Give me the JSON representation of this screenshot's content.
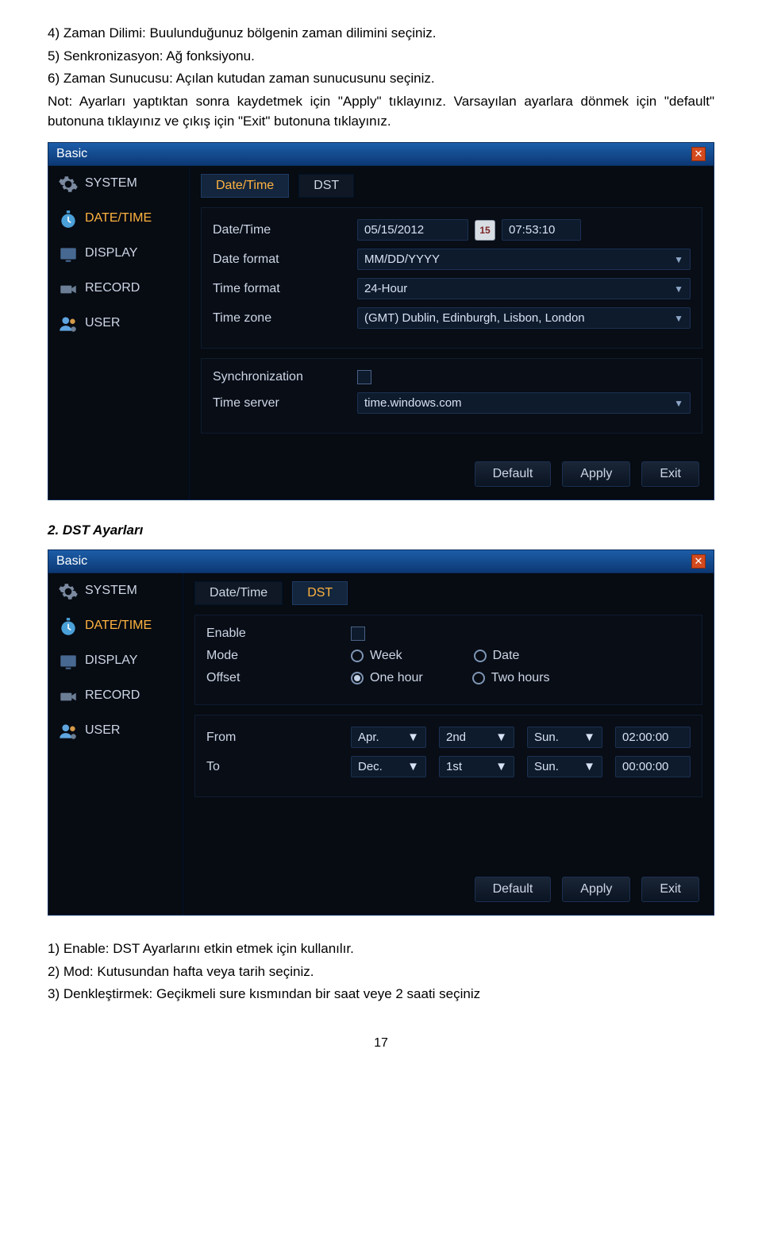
{
  "doc": {
    "line1": "4)    Zaman Dilimi: Buulunduğunuz bölgenin zaman dilimini seçiniz.",
    "line2": "5)    Senkronizasyon: Ağ fonksiyonu.",
    "line3": "6)    Zaman Sunucusu: Açılan kutudan zaman sunucusunu seçiniz.",
    "line4": "Not: Ayarları yaptıktan sonra kaydetmek için \"Apply\" tıklayınız. Varsayılan ayarlara dönmek için \"default\" butonuna tıklayınız ve çıkış için \"Exit\" butonuna tıklayınız.",
    "heading2": "2.    DST Ayarları",
    "after1": "1)  Enable: DST Ayarlarını etkin etmek için kullanılır.",
    "after2": "2)  Mod:    Kutusundan hafta veya tarih seçiniz.",
    "after3": "3)  Denkleştirmek: Geçikmeli sure kısmından bir saat veye 2 saati seçiniz",
    "page_num": "17"
  },
  "panel1": {
    "title": "Basic",
    "sidebar": [
      "SYSTEM",
      "DATE/TIME",
      "DISPLAY",
      "RECORD",
      "USER"
    ],
    "tabs": [
      "Date/Time",
      "DST"
    ],
    "labels": {
      "date_time": "Date/Time",
      "date_format": "Date format",
      "time_format": "Time format",
      "time_zone": "Time zone",
      "sync": "Synchronization",
      "time_server": "Time server"
    },
    "values": {
      "date": "05/15/2012",
      "cal_day": "15",
      "time": "07:53:10",
      "date_format": "MM/DD/YYYY",
      "time_format": "24-Hour",
      "time_zone": "(GMT) Dublin, Edinburgh, Lisbon, London",
      "time_server": "time.windows.com"
    },
    "buttons": [
      "Default",
      "Apply",
      "Exit"
    ]
  },
  "panel2": {
    "title": "Basic",
    "tabs": [
      "Date/Time",
      "DST"
    ],
    "labels": {
      "enable": "Enable",
      "mode": "Mode",
      "offset": "Offset",
      "from": "From",
      "to": "To",
      "week": "Week",
      "date": "Date",
      "one_hour": "One hour",
      "two_hours": "Two hours"
    },
    "from": {
      "month": "Apr.",
      "week": "2nd",
      "day": "Sun.",
      "time": "02:00:00"
    },
    "to": {
      "month": "Dec.",
      "week": "1st",
      "day": "Sun.",
      "time": "00:00:00"
    },
    "buttons": [
      "Default",
      "Apply",
      "Exit"
    ]
  }
}
